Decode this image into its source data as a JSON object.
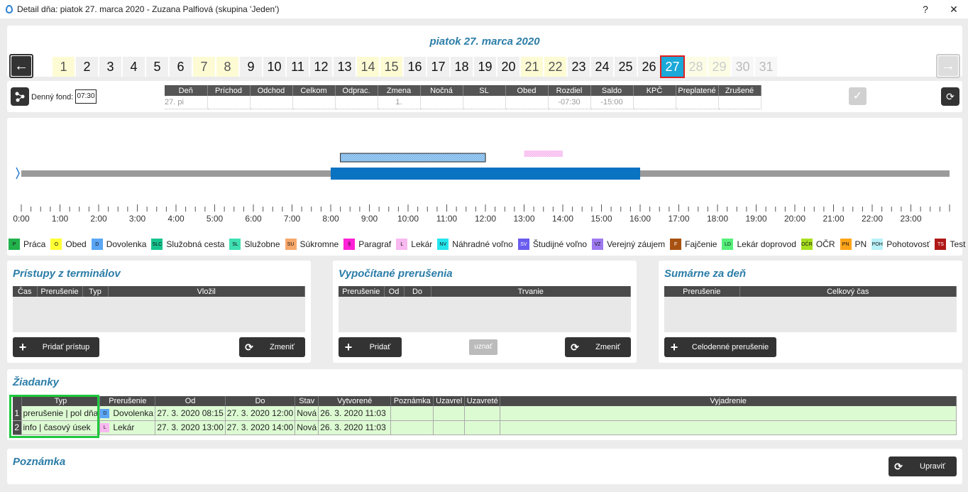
{
  "window": {
    "title": "Detail dňa: piatok 27. marca 2020 -  Zuzana Palfiová  (skupina 'Jeden')",
    "help": "?",
    "close": "✕"
  },
  "date_header": "piatok 27. marca 2020",
  "days": [
    {
      "n": "1",
      "t": "we"
    },
    {
      "n": "2",
      "t": ""
    },
    {
      "n": "3",
      "t": ""
    },
    {
      "n": "4",
      "t": ""
    },
    {
      "n": "5",
      "t": ""
    },
    {
      "n": "6",
      "t": ""
    },
    {
      "n": "7",
      "t": "we"
    },
    {
      "n": "8",
      "t": "we"
    },
    {
      "n": "9",
      "t": ""
    },
    {
      "n": "10",
      "t": ""
    },
    {
      "n": "11",
      "t": ""
    },
    {
      "n": "12",
      "t": ""
    },
    {
      "n": "13",
      "t": ""
    },
    {
      "n": "14",
      "t": "we"
    },
    {
      "n": "15",
      "t": "we"
    },
    {
      "n": "16",
      "t": ""
    },
    {
      "n": "17",
      "t": ""
    },
    {
      "n": "18",
      "t": ""
    },
    {
      "n": "19",
      "t": ""
    },
    {
      "n": "20",
      "t": ""
    },
    {
      "n": "21",
      "t": "we"
    },
    {
      "n": "22",
      "t": "we"
    },
    {
      "n": "23",
      "t": ""
    },
    {
      "n": "24",
      "t": ""
    },
    {
      "n": "25",
      "t": ""
    },
    {
      "n": "26",
      "t": ""
    },
    {
      "n": "27",
      "t": "sel"
    },
    {
      "n": "28",
      "t": "we fut"
    },
    {
      "n": "29",
      "t": "we fut"
    },
    {
      "n": "30",
      "t": "fut"
    },
    {
      "n": "31",
      "t": "fut"
    }
  ],
  "summary": {
    "fund_label": "Denný fond:",
    "fund_value": "07:30",
    "headers": [
      "Deň",
      "Príchod",
      "Odchod",
      "Celkom",
      "Odprac.",
      "Zmena",
      "Nočná",
      "SL",
      "Obed",
      "Rozdiel",
      "Saldo",
      "KPČ",
      "Preplatené",
      "Zrušené"
    ],
    "row": [
      "27. pi",
      "",
      "",
      "",
      "",
      "1.",
      "",
      "",
      "",
      "-07:30",
      "-15:00",
      "",
      "",
      ""
    ]
  },
  "timeline": {
    "hours": [
      "0:00",
      "1:00",
      "2:00",
      "3:00",
      "4:00",
      "5:00",
      "6:00",
      "7:00",
      "8:00",
      "9:00",
      "10:00",
      "11:00",
      "12:00",
      "13:00",
      "14:00",
      "15:00",
      "16:00",
      "17:00",
      "18:00",
      "19:00",
      "20:00",
      "21:00",
      "22:00",
      "23:00"
    ],
    "shift": {
      "start": 8,
      "end": 16
    },
    "request1": {
      "start": 8.25,
      "end": 12
    },
    "request2": {
      "start": 13,
      "end": 14
    }
  },
  "legend": [
    {
      "code": "P",
      "label": "Práca",
      "color": "#22b24c"
    },
    {
      "code": "O",
      "label": "Obed",
      "color": "#ffff33"
    },
    {
      "code": "D",
      "label": "Dovolenka",
      "color": "#5aa6f5"
    },
    {
      "code": "SLC",
      "label": "Služobná cesta",
      "color": "#18c48e"
    },
    {
      "code": "SL",
      "label": "Služobne",
      "color": "#3fe0b2"
    },
    {
      "code": "SU",
      "label": "Súkromne",
      "color": "#f7a86b"
    },
    {
      "code": "§",
      "label": "Paragraf",
      "color": "#ff20d8"
    },
    {
      "code": "L",
      "label": "Lekár",
      "color": "#f8b8f0"
    },
    {
      "code": "NV",
      "label": "Náhradné voľno",
      "color": "#25e6ee"
    },
    {
      "code": "SV",
      "label": "Študijné voľno",
      "color": "#6a5cf0"
    },
    {
      "code": "VZ",
      "label": "Verejný záujem",
      "color": "#9e7af0"
    },
    {
      "code": "F",
      "label": "Fajčenie",
      "color": "#a85212"
    },
    {
      "code": "LD",
      "label": "Lekár doprovod",
      "color": "#55f07a"
    },
    {
      "code": "OČR",
      "label": "OČR",
      "color": "#a8e020"
    },
    {
      "code": "PN",
      "label": "PN",
      "color": "#ffa418"
    },
    {
      "code": "POH",
      "label": "Pohotovosť",
      "color": "#b8f2f8"
    },
    {
      "code": "TS",
      "label": "Test",
      "color": "#b01818"
    }
  ],
  "panels": {
    "pristupy": {
      "title": "Prístupy z terminálov",
      "headers": [
        "Čas",
        "Prerušenie",
        "Typ",
        "Vložil"
      ],
      "add": "Pridať prístup",
      "change": "Zmeniť"
    },
    "vypocitane": {
      "title": "Vypočítané prerušenia",
      "headers": [
        "Prerušenie",
        "Od",
        "Do",
        "Trvanie"
      ],
      "add": "Pridať",
      "approve": "uznať",
      "change": "Zmeniť"
    },
    "sumarne": {
      "title": "Sumárne za deň",
      "headers": [
        "Prerušenie",
        "Celkový čas"
      ],
      "add": "Celodenné prerušenie"
    }
  },
  "ziadanky": {
    "title": "Žiadanky",
    "headers": [
      "Typ",
      "Prerušenie",
      "Od",
      "Do",
      "Stav",
      "Vytvorené",
      "Poznámka",
      "Uzavrel",
      "Uzavreté",
      "Vyjadrenie"
    ],
    "rows": [
      {
        "n": "1",
        "typ": "prerušenie | pol dňa",
        "code": "D",
        "code_color": "#5aa6f5",
        "prerusenie": "Dovolenka",
        "od": "27. 3. 2020 08:15",
        "do": "27. 3. 2020 12:00",
        "stav": "Nová",
        "vytvorene": "26. 3. 2020  11:03"
      },
      {
        "n": "2",
        "typ": "info | časový úsek",
        "code": "L",
        "code_color": "#f8b8f0",
        "prerusenie": "Lekár",
        "od": "27. 3. 2020 13:00",
        "do": "27. 3. 2020 14:00",
        "stav": "Nová",
        "vytvorene": "26. 3. 2020  11:03"
      }
    ]
  },
  "poznamka": {
    "title": "Poznámka",
    "edit": "Upraviť"
  }
}
